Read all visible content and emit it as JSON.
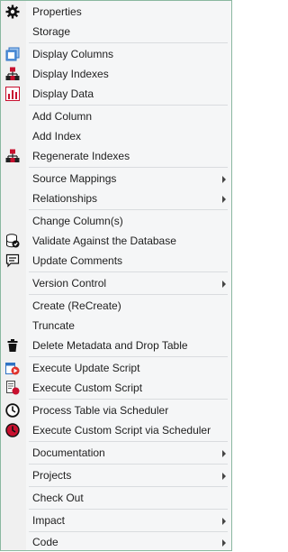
{
  "menu": {
    "items": [
      {
        "label": "Properties",
        "icon": "gear-icon",
        "submenu": false
      },
      {
        "label": "Storage",
        "icon": "",
        "submenu": false
      },
      {
        "label": "Display Columns",
        "icon": "columns-icon",
        "submenu": false
      },
      {
        "label": "Display Indexes",
        "icon": "index-hierarchy-icon",
        "submenu": false
      },
      {
        "label": "Display Data",
        "icon": "data-chart-icon",
        "submenu": false
      },
      {
        "label": "Add Column",
        "icon": "",
        "submenu": false
      },
      {
        "label": "Add Index",
        "icon": "",
        "submenu": false
      },
      {
        "label": "Regenerate Indexes",
        "icon": "index-hierarchy-icon",
        "submenu": false
      },
      {
        "label": "Source Mappings",
        "icon": "",
        "submenu": true
      },
      {
        "label": "Relationships",
        "icon": "",
        "submenu": true
      },
      {
        "label": "Change Column(s)",
        "icon": "",
        "submenu": false
      },
      {
        "label": "Validate Against the Database",
        "icon": "database-validate-icon",
        "submenu": false
      },
      {
        "label": "Update Comments",
        "icon": "comment-icon",
        "submenu": false
      },
      {
        "label": "Version Control",
        "icon": "",
        "submenu": true
      },
      {
        "label": "Create (ReCreate)",
        "icon": "",
        "submenu": false
      },
      {
        "label": "Truncate",
        "icon": "",
        "submenu": false
      },
      {
        "label": "Delete Metadata and Drop Table",
        "icon": "trash-icon",
        "submenu": false
      },
      {
        "label": "Execute Update Script",
        "icon": "execute-script-icon",
        "submenu": false
      },
      {
        "label": "Execute Custom Script",
        "icon": "custom-script-icon",
        "submenu": false
      },
      {
        "label": "Process Table via Scheduler",
        "icon": "clock-icon",
        "submenu": false
      },
      {
        "label": "Execute Custom Script via Scheduler",
        "icon": "red-clock-icon",
        "submenu": false
      },
      {
        "label": "Documentation",
        "icon": "",
        "submenu": true
      },
      {
        "label": "Projects",
        "icon": "",
        "submenu": true
      },
      {
        "label": "Check Out",
        "icon": "",
        "submenu": false
      },
      {
        "label": "Impact",
        "icon": "",
        "submenu": true
      },
      {
        "label": "Code",
        "icon": "",
        "submenu": true
      }
    ]
  },
  "colors": {
    "border": "#8ab8a0",
    "menu_bg": "#f5f6f7",
    "separator": "#d9dcdf",
    "accent_blue": "#2f72c4",
    "accent_red": "#c8102e"
  }
}
